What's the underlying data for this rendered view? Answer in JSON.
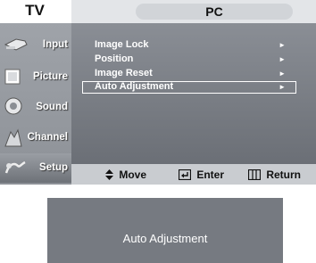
{
  "header": {
    "left_title": "TV",
    "section_title": "PC"
  },
  "sidebar": {
    "items": [
      {
        "label": "Input",
        "icon": "input-icon"
      },
      {
        "label": "Picture",
        "icon": "picture-icon"
      },
      {
        "label": "Sound",
        "icon": "sound-icon"
      },
      {
        "label": "Channel",
        "icon": "channel-icon"
      },
      {
        "label": "Setup",
        "icon": "setup-icon"
      }
    ]
  },
  "menu": {
    "items": [
      {
        "label": "Image Lock",
        "arrow": "►"
      },
      {
        "label": "Position",
        "arrow": "►"
      },
      {
        "label": "Image Reset",
        "arrow": "►"
      },
      {
        "label": "Auto Adjustment",
        "arrow": "►",
        "selected": true
      }
    ]
  },
  "nav": {
    "move_label": "Move",
    "enter_label": "Enter",
    "return_label": "Return",
    "move_icon": "updown-icon",
    "enter_icon": "enter-icon",
    "return_icon": "menu-return-icon"
  },
  "dialog": {
    "title": "Auto Adjustment"
  },
  "colors": {
    "osd_background": "#b7bbc1",
    "menu_panel": "#7b7f86",
    "selection_border": "#ffffff",
    "dialog_background": "#767a81"
  }
}
